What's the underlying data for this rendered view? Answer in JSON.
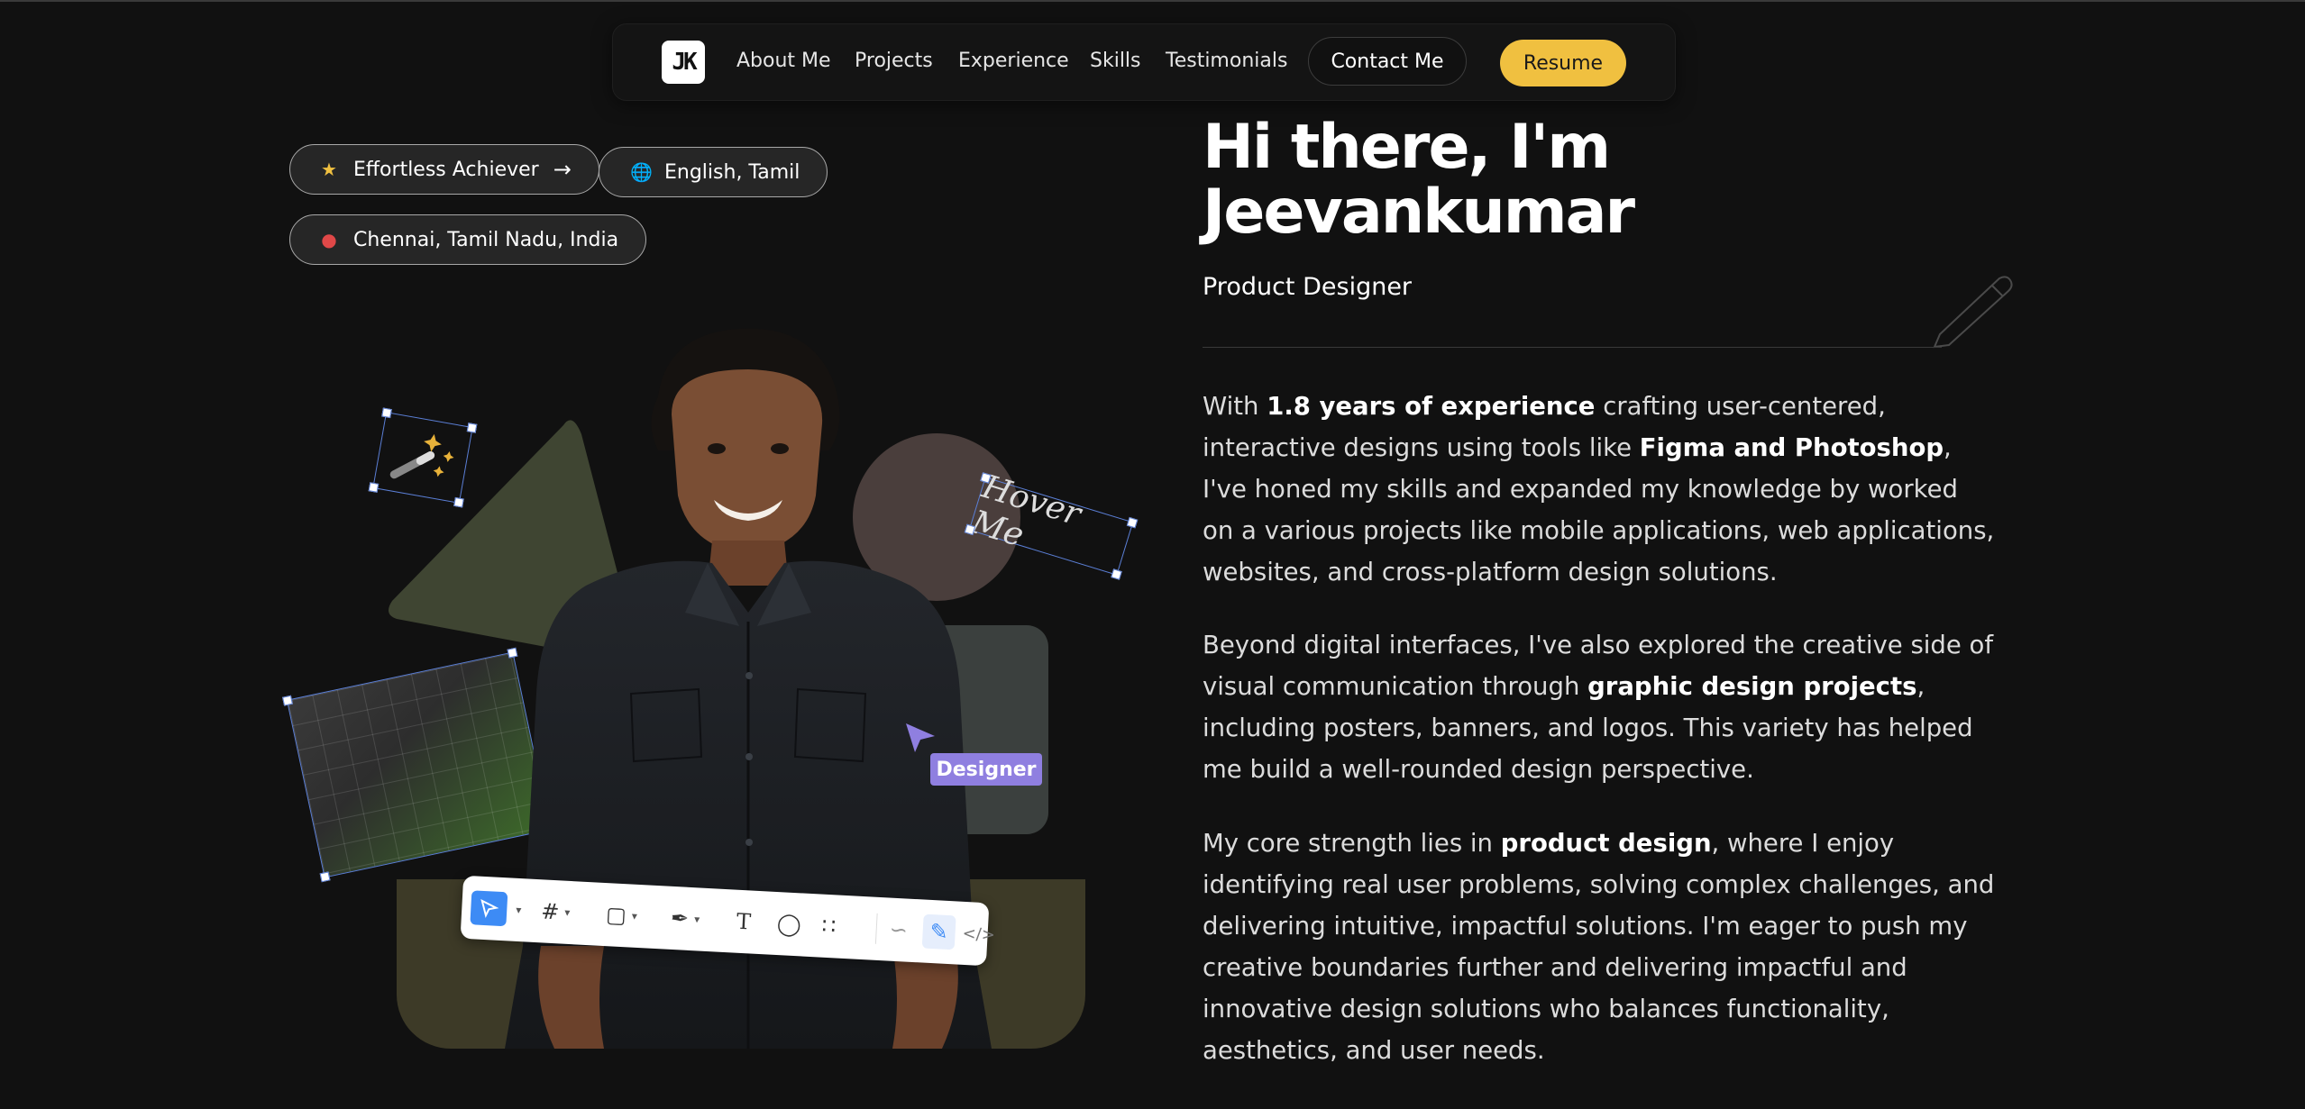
{
  "nav": {
    "logo": "JK",
    "links": [
      "About Me",
      "Projects",
      "Experience",
      "Skills",
      "Testimonials"
    ],
    "contact_label": "Contact Me",
    "resume_label": "Resume",
    "resume_color": "#f0c040"
  },
  "chips": {
    "achiever": "Effortless Achiever",
    "languages": "English, Tamil",
    "location": "Chennai, Tamil Nadu, India"
  },
  "illustration": {
    "hover_label": "Hover Me",
    "designer_tag": "Designer",
    "toolbar_icons": [
      "move-tool-icon",
      "frame-tool-icon",
      "shape-tool-icon",
      "pen-tool-icon",
      "text-tool-icon",
      "comment-tool-icon",
      "actions-icon",
      "draw-mode-icon",
      "design-mode-icon",
      "dev-mode-icon"
    ]
  },
  "hero": {
    "title_line1": "Hi there, I'm",
    "title_line2": "Jeevankumar",
    "role": "Product Designer"
  },
  "about": {
    "p1": {
      "a": "With ",
      "b": "1.8 years of experience",
      "c": " crafting user-centered, interactive designs using tools like ",
      "d": "Figma and Photoshop",
      "e": ", I've honed my skills and expanded my knowledge by worked on a various projects like mobile applications, web applications, websites, and cross-platform design solutions."
    },
    "p2": {
      "a": "Beyond digital interfaces, I've also explored the creative side of visual communication through ",
      "b": "graphic design projects",
      "c": ", including posters, banners, and logos. This variety has helped me build a well-rounded design perspective."
    },
    "p3": {
      "a": "My core strength lies in ",
      "b": "product design",
      "c": ", where I enjoy identifying real user problems, solving complex challenges, and delivering intuitive, impactful solutions. I'm eager to push my creative boundaries further and delivering impactful and innovative design solutions who balances functionality, aesthetics, and user needs."
    }
  }
}
